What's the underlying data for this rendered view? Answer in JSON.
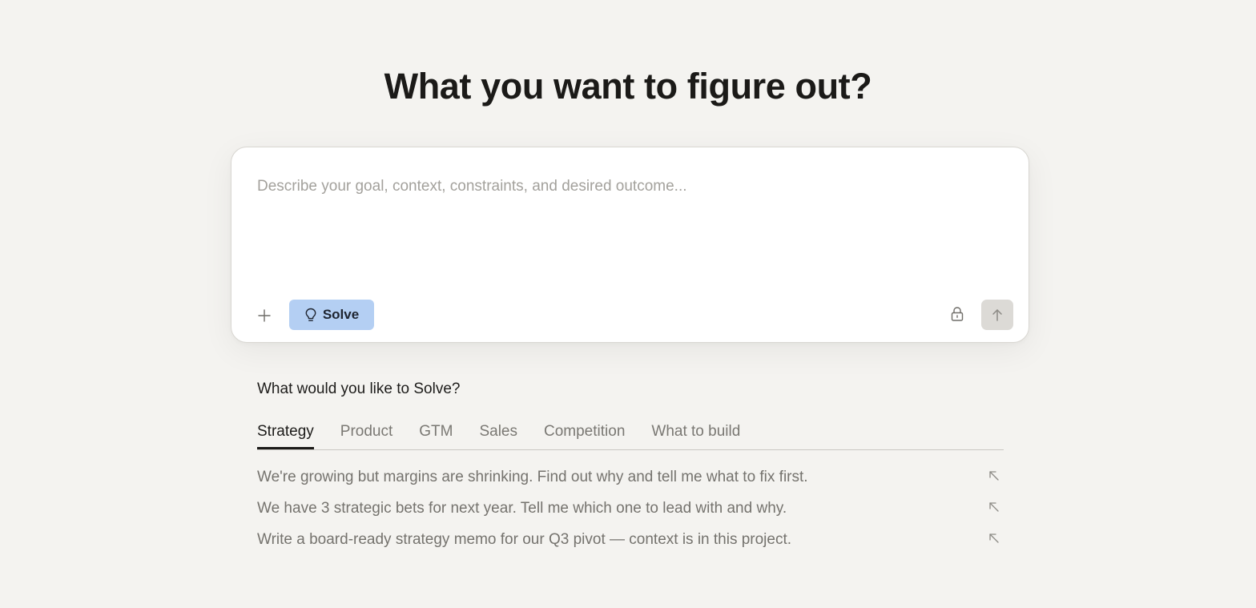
{
  "header": {
    "title": "What you want to figure out?"
  },
  "composer": {
    "placeholder": "Describe your goal, context, constraints, and desired outcome...",
    "value": "",
    "add_icon": "plus-icon",
    "mode_button": {
      "label": "Solve",
      "icon": "lightbulb-icon",
      "color": "#b4cff3"
    },
    "lock_icon": "lock-icon",
    "send_icon": "arrow-up-icon"
  },
  "suggestions_section": {
    "heading": "What would you like to Solve?",
    "tabs": [
      {
        "label": "Strategy",
        "active": true
      },
      {
        "label": "Product",
        "active": false
      },
      {
        "label": "GTM",
        "active": false
      },
      {
        "label": "Sales",
        "active": false
      },
      {
        "label": "Competition",
        "active": false
      },
      {
        "label": "What to build",
        "active": false
      }
    ],
    "items": [
      {
        "text": "We're growing but margins are shrinking. Find out why and tell me what to fix first.",
        "icon": "arrow-up-left-icon"
      },
      {
        "text": "We have 3 strategic bets for next year. Tell me which one to lead with and why.",
        "icon": "arrow-up-left-icon"
      },
      {
        "text": "Write a board-ready strategy memo for our Q3 pivot — context is in this project.",
        "icon": "arrow-up-left-icon"
      }
    ]
  }
}
